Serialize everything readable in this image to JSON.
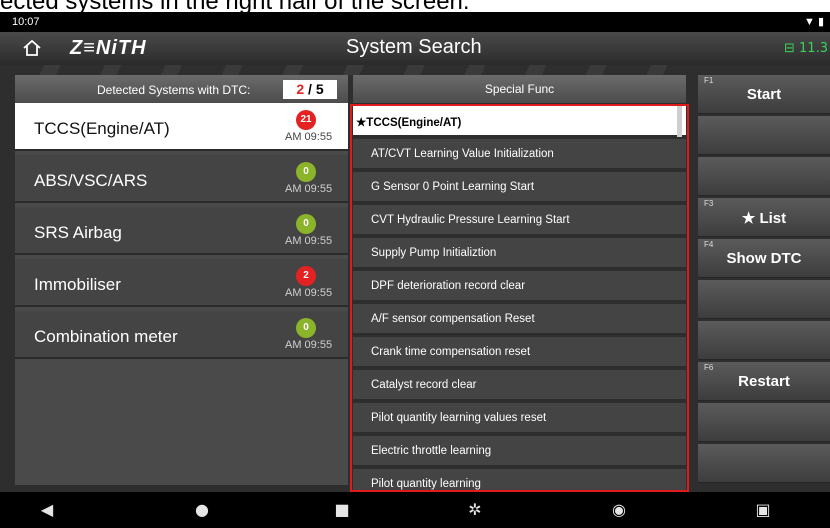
{
  "caption": "ected systems in the right half of the screen.",
  "status_bar": {
    "time": "10:07",
    "icons": "▼ ▮"
  },
  "header": {
    "brand": "Z≡NiTH",
    "title": "System Search",
    "battery": "⊟ 11.3"
  },
  "detected": {
    "label": "Detected Systems with DTC:",
    "count": "2",
    "sep": " / ",
    "total": "5"
  },
  "systems": [
    {
      "name": "TCCS(Engine/AT)",
      "badge": "21",
      "badge_color": "red",
      "time": "AM 09:55",
      "selected": true
    },
    {
      "name": "ABS/VSC/ARS",
      "badge": "0",
      "badge_color": "green",
      "time": "AM 09:55"
    },
    {
      "name": "SRS Airbag",
      "badge": "0",
      "badge_color": "green",
      "time": "AM 09:55"
    },
    {
      "name": "Immobiliser",
      "badge": "2",
      "badge_color": "red",
      "time": "AM 09:55"
    },
    {
      "name": "Combination meter",
      "badge": "0",
      "badge_color": "green",
      "time": "AM 09:55"
    }
  ],
  "special_func": {
    "header": "Special Func",
    "items": [
      "★TCCS(Engine/AT)",
      "AT/CVT Learning Value Initialization",
      "G Sensor 0 Point Learning Start",
      "CVT Hydraulic Pressure Learning Start",
      "Supply Pump Initializtion",
      "DPF deterioration record clear",
      "A/F sensor compensation Reset",
      "Crank time compensation reset",
      "Catalyst record clear",
      "Pilot quantity learning values reset",
      "Electric throttle learning",
      "Pilot quantity learning"
    ]
  },
  "function_keys": [
    {
      "key": "F1",
      "label": "Start"
    },
    {
      "key": "",
      "label": ""
    },
    {
      "key": "",
      "label": ""
    },
    {
      "key": "F3",
      "label": "★ List"
    },
    {
      "key": "F4",
      "label": "Show DTC"
    },
    {
      "key": "",
      "label": ""
    },
    {
      "key": "",
      "label": ""
    },
    {
      "key": "F6",
      "label": "Restart"
    },
    {
      "key": "",
      "label": ""
    },
    {
      "key": "",
      "label": ""
    }
  ],
  "nav_icons": [
    "back-icon",
    "home-icon",
    "recents-icon",
    "settings-icon",
    "chrome-icon",
    "screenshot-icon"
  ],
  "colors": {
    "highlight_border": "#e11b1b",
    "dtc_red": "#e42222",
    "ok_green": "#8bb42b",
    "battery_green": "#39d15b"
  }
}
